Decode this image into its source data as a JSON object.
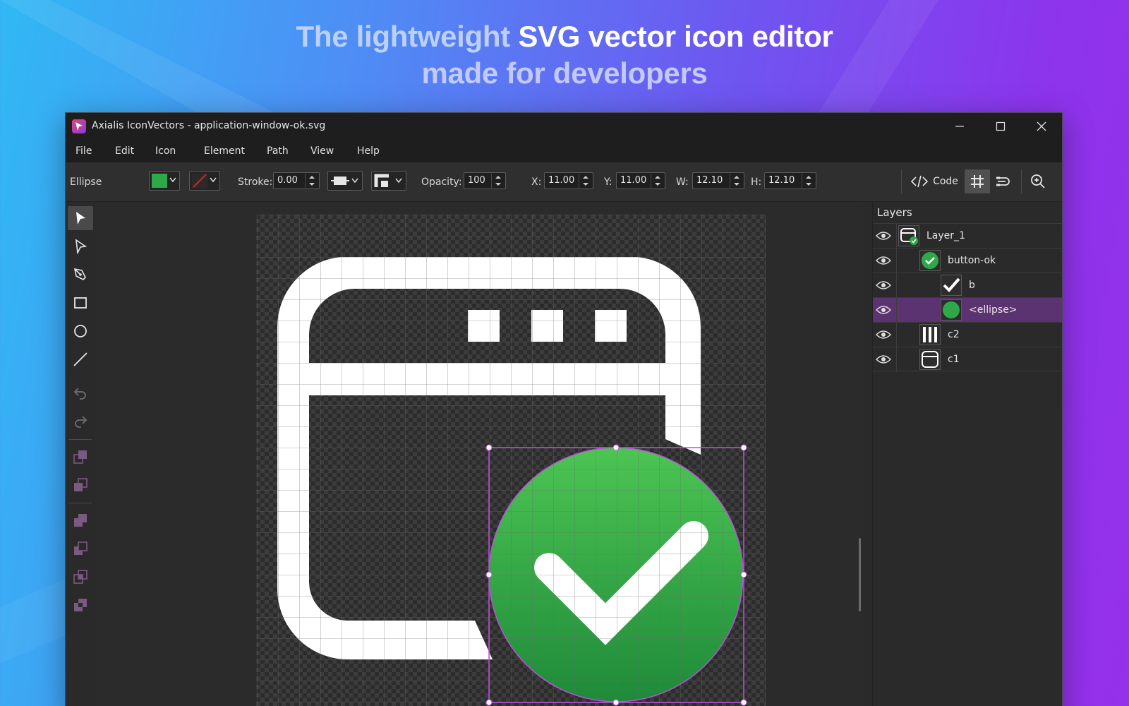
{
  "headline": {
    "line1_muted": "The lightweight",
    "line1_bright": "SVG vector icon editor",
    "line2": "made for developers"
  },
  "window": {
    "title": "Axialis IconVectors - application-window-ok.svg",
    "controls": {
      "minimize": "minimize-icon",
      "maximize": "maximize-icon",
      "close": "close-icon"
    }
  },
  "menu": [
    "File",
    "Edit",
    "Icon",
    "Element",
    "Path",
    "View",
    "Help"
  ],
  "properties": {
    "element_type": "Ellipse",
    "fill_color": "#2fa84a",
    "stroke_color": "#d42525",
    "stroke_label": "Stroke:",
    "stroke_value": "0.00",
    "opacity_label": "Opacity:",
    "opacity_value": "100",
    "x_label": "X:",
    "x_value": "11.00",
    "y_label": "Y:",
    "y_value": "11.00",
    "w_label": "W:",
    "w_value": "12.10",
    "h_label": "H:",
    "h_value": "12.10",
    "code_label": "Code"
  },
  "tools": [
    "select-arrow-icon",
    "direct-select-icon",
    "pen-icon",
    "rectangle-icon",
    "ellipse-icon",
    "line-icon",
    "undo-icon",
    "redo-icon",
    "bring-front-icon",
    "send-back-icon",
    "union-icon",
    "subtract-icon",
    "intersect-icon",
    "exclude-icon"
  ],
  "layers": {
    "title": "Layers",
    "items": [
      {
        "name": "Layer_1",
        "thumb": "window-ok-thumb",
        "selected": false
      },
      {
        "name": "button-ok",
        "thumb": "green-check-thumb",
        "selected": false
      },
      {
        "name": "b",
        "thumb": "checkmark-thumb",
        "selected": false
      },
      {
        "name": "<ellipse>",
        "thumb": "green-circle-thumb",
        "selected": true
      },
      {
        "name": "c2",
        "thumb": "bars-thumb",
        "selected": false
      },
      {
        "name": "c1",
        "thumb": "window-frame-thumb",
        "selected": false
      }
    ]
  },
  "colors": {
    "accent_selection": "#b14ad6",
    "selected_row": "#5b3370",
    "ok_green_top": "#4cc553",
    "ok_green_bottom": "#1f8a3a"
  }
}
